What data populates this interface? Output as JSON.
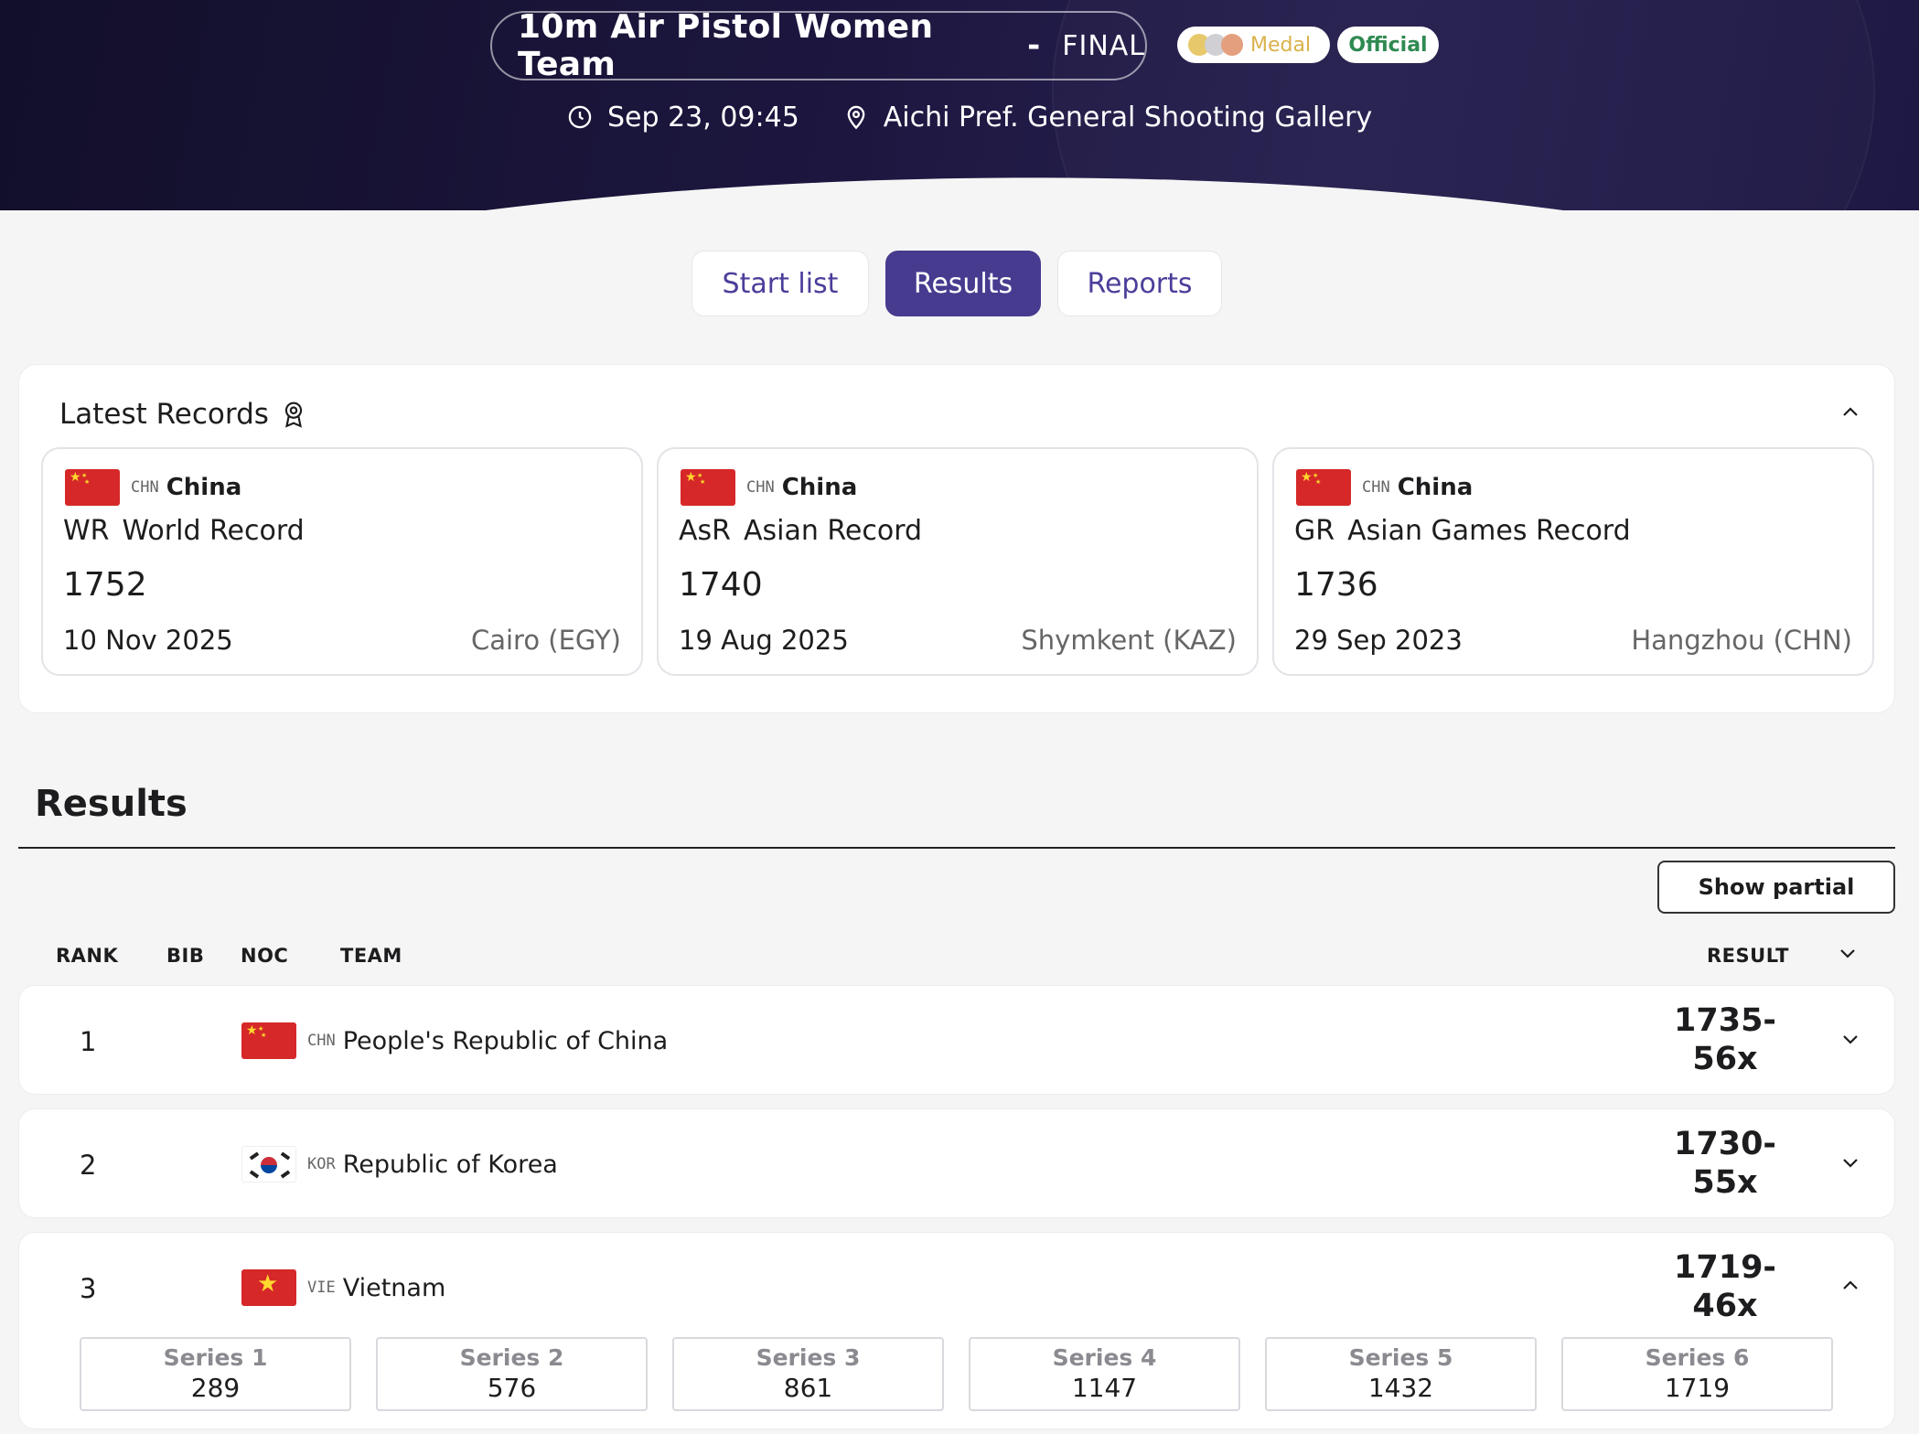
{
  "header": {
    "event_name": "10m Air Pistol Women Team",
    "separator": "-",
    "phase": "FINAL",
    "badges": {
      "medal": "Medal",
      "official": "Official"
    },
    "datetime": "Sep 23, 09:45",
    "venue": "Aichi Pref. General Shooting Gallery"
  },
  "tabs": [
    {
      "label": "Start list",
      "active": false
    },
    {
      "label": "Results",
      "active": true
    },
    {
      "label": "Reports",
      "active": false
    }
  ],
  "records": {
    "title": "Latest Records",
    "items": [
      {
        "noc": "CHN",
        "country": "China",
        "abbr": "WR",
        "type": "World Record",
        "value": "1752",
        "date": "10 Nov 2025",
        "place": "Cairo (EGY)"
      },
      {
        "noc": "CHN",
        "country": "China",
        "abbr": "AsR",
        "type": "Asian Record",
        "value": "1740",
        "date": "19 Aug 2025",
        "place": "Shymkent (KAZ)"
      },
      {
        "noc": "CHN",
        "country": "China",
        "abbr": "GR",
        "type": "Asian Games Record",
        "value": "1736",
        "date": "29 Sep 2023",
        "place": "Hangzhou (CHN)"
      }
    ]
  },
  "results": {
    "title": "Results",
    "show_partial": "Show partial",
    "columns": {
      "rank": "RANK",
      "bib": "BIB",
      "noc": "NOC",
      "team": "TEAM",
      "result": "RESULT"
    },
    "rows": [
      {
        "rank": "1",
        "noc": "CHN",
        "team": "People's Republic of China",
        "result_line1": "1735-",
        "result_line2": "56x"
      },
      {
        "rank": "2",
        "noc": "KOR",
        "team": "Republic of Korea",
        "result_line1": "1730-",
        "result_line2": "55x"
      },
      {
        "rank": "3",
        "noc": "VIE",
        "team": "Vietnam",
        "result_line1": "1719-",
        "result_line2": "46x",
        "series": [
          {
            "label": "Series 1",
            "value": "289"
          },
          {
            "label": "Series 2",
            "value": "576"
          },
          {
            "label": "Series 3",
            "value": "861"
          },
          {
            "label": "Series 4",
            "value": "1147"
          },
          {
            "label": "Series 5",
            "value": "1432"
          },
          {
            "label": "Series 6",
            "value": "1719"
          }
        ]
      }
    ]
  },
  "colors": {
    "accent": "#463b8f",
    "hero_bg": "#1d1740",
    "medal_text": "#d9b24a",
    "official_text": "#2f8a52"
  }
}
